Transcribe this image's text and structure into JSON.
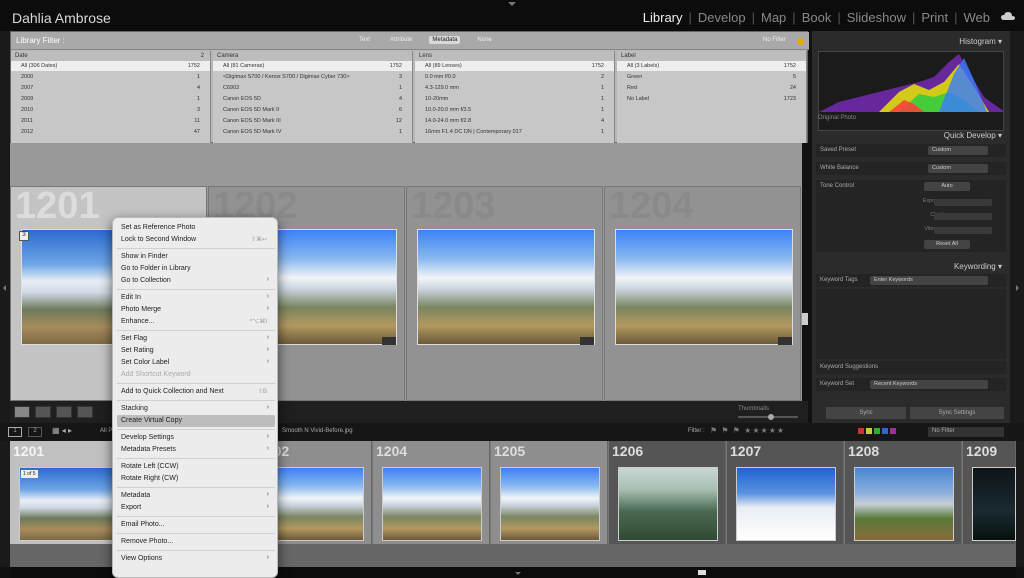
{
  "identity": "Dahlia Ambrose",
  "modules": [
    "Library",
    "Develop",
    "Map",
    "Book",
    "Slideshow",
    "Print",
    "Web"
  ],
  "active_module": "Library",
  "library_filter": {
    "title": "Library Filter :",
    "tabs": [
      "Text",
      "Attribute",
      "Metadata",
      "None"
    ],
    "active_tab": "Metadata",
    "preset": "No Filter",
    "columns": [
      {
        "header": "Date",
        "header_count": "2",
        "rows": [
          {
            "label": "All (306 Dates)",
            "count": "1752"
          },
          {
            "label": "2000",
            "count": "1"
          },
          {
            "label": "2007",
            "count": "4"
          },
          {
            "label": "2009",
            "count": "1"
          },
          {
            "label": "2010",
            "count": "3"
          },
          {
            "label": "2011",
            "count": "11"
          },
          {
            "label": "2012",
            "count": "47"
          }
        ]
      },
      {
        "header": "Camera",
        "header_count": "",
        "rows": [
          {
            "label": "All (81 Cameras)",
            "count": "1752"
          },
          {
            "label": "<Digimax S700 / Kenox S700 / Digimax Cyber 730>",
            "count": "3"
          },
          {
            "label": "C6903",
            "count": "1"
          },
          {
            "label": "Canon EOS 5D",
            "count": "4"
          },
          {
            "label": "Canon EOS 5D Mark II",
            "count": "6"
          },
          {
            "label": "Canon EOS 5D Mark III",
            "count": "12"
          },
          {
            "label": "Canon EOS 5D Mark IV",
            "count": "1"
          }
        ]
      },
      {
        "header": "Lens",
        "header_count": "",
        "rows": [
          {
            "label": "All (89 Lenses)",
            "count": "1752"
          },
          {
            "label": "0.0 mm f/0.0",
            "count": "2"
          },
          {
            "label": "4.3-129.0 mm",
            "count": "1"
          },
          {
            "label": "10-20mm",
            "count": "1"
          },
          {
            "label": "10.0-20.0 mm f/3.5",
            "count": "1"
          },
          {
            "label": "14.0-24.0 mm f/2.8",
            "count": "4"
          },
          {
            "label": "16mm F1.4 DC DN | Contemporary 017",
            "count": "1"
          }
        ]
      },
      {
        "header": "Label",
        "header_count": "",
        "rows": [
          {
            "label": "All (3 Labels)",
            "count": "1752"
          },
          {
            "label": "Green",
            "count": "5"
          },
          {
            "label": "Red",
            "count": "24"
          },
          {
            "label": "No Label",
            "count": "1723"
          }
        ]
      }
    ]
  },
  "grid": {
    "cells": [
      {
        "number": "1201",
        "badge": "3"
      },
      {
        "number": "1202",
        "badge": ""
      },
      {
        "number": "1203",
        "badge": ""
      },
      {
        "number": "1204",
        "badge": ""
      }
    ],
    "thumbnails_label": "Thumbnails"
  },
  "right_panel": {
    "histogram_title": "Histogram",
    "original_photo": "Original Photo",
    "quick_develop_title": "Quick Develop",
    "saved_preset_label": "Saved Preset",
    "saved_preset_value": "Custom",
    "white_balance_label": "White Balance",
    "white_balance_value": "Custom",
    "tone_control_label": "Tone Control",
    "auto_label": "Auto",
    "tone_rows": [
      "Exposure",
      "Clarity",
      "Vibrance"
    ],
    "reset_all": "Reset All",
    "keywording_title": "Keywording",
    "keyword_tags_label": "Keyword Tags",
    "keyword_tags_value": "Enter Keywords",
    "keyword_suggestions": "Keyword Suggestions",
    "keyword_set_label": "Keyword Set",
    "keyword_set_value": "Recent Keywords",
    "sync": "Sync",
    "sync_settings": "Sync Settings"
  },
  "filmstrip_bar": {
    "view_buttons": [
      "1",
      "2"
    ],
    "path_prefix": "All P",
    "path_suffix": "Smooth N Vivid-Before.jpg",
    "filter_label": "Filter :",
    "filter_value": "No Filter"
  },
  "filmstrip": [
    {
      "number": "1201",
      "badge": "1 of 5"
    },
    {
      "number": "1202",
      "badge": ""
    },
    {
      "number": "1204",
      "badge": ""
    },
    {
      "number": "1205",
      "badge": ""
    },
    {
      "number": "1206",
      "badge": ""
    },
    {
      "number": "1207",
      "badge": ""
    },
    {
      "number": "1208",
      "badge": ""
    },
    {
      "number": "1209",
      "badge": ""
    }
  ],
  "context_menu": {
    "items": [
      {
        "label": "Set as Reference Photo",
        "shortcut": "",
        "submenu": false,
        "disabled": false,
        "highlighted": false,
        "sep_after": false
      },
      {
        "label": "Lock to Second Window",
        "shortcut": "⇧⌘↩",
        "submenu": false,
        "disabled": false,
        "highlighted": false,
        "sep_after": true
      },
      {
        "label": "Show in Finder",
        "shortcut": "",
        "submenu": false,
        "disabled": false,
        "highlighted": false,
        "sep_after": false
      },
      {
        "label": "Go to Folder in Library",
        "shortcut": "",
        "submenu": false,
        "disabled": false,
        "highlighted": false,
        "sep_after": false
      },
      {
        "label": "Go to Collection",
        "shortcut": "",
        "submenu": true,
        "disabled": false,
        "highlighted": false,
        "sep_after": true
      },
      {
        "label": "Edit In",
        "shortcut": "",
        "submenu": true,
        "disabled": false,
        "highlighted": false,
        "sep_after": false
      },
      {
        "label": "Photo Merge",
        "shortcut": "",
        "submenu": true,
        "disabled": false,
        "highlighted": false,
        "sep_after": false
      },
      {
        "label": "Enhance...",
        "shortcut": "^⌥⌘I",
        "submenu": false,
        "disabled": false,
        "highlighted": false,
        "sep_after": true
      },
      {
        "label": "Set Flag",
        "shortcut": "",
        "submenu": true,
        "disabled": false,
        "highlighted": false,
        "sep_after": false
      },
      {
        "label": "Set Rating",
        "shortcut": "",
        "submenu": true,
        "disabled": false,
        "highlighted": false,
        "sep_after": false
      },
      {
        "label": "Set Color Label",
        "shortcut": "",
        "submenu": true,
        "disabled": false,
        "highlighted": false,
        "sep_after": false
      },
      {
        "label": "Add Shortcut Keyword",
        "shortcut": "",
        "submenu": false,
        "disabled": true,
        "highlighted": false,
        "sep_after": true
      },
      {
        "label": "Add to Quick Collection and Next",
        "shortcut": "⇧B",
        "submenu": false,
        "disabled": false,
        "highlighted": false,
        "sep_after": true
      },
      {
        "label": "Stacking",
        "shortcut": "",
        "submenu": true,
        "disabled": false,
        "highlighted": false,
        "sep_after": false
      },
      {
        "label": "Create Virtual Copy",
        "shortcut": "",
        "submenu": false,
        "disabled": false,
        "highlighted": true,
        "sep_after": true
      },
      {
        "label": "Develop Settings",
        "shortcut": "",
        "submenu": true,
        "disabled": false,
        "highlighted": false,
        "sep_after": false
      },
      {
        "label": "Metadata Presets",
        "shortcut": "",
        "submenu": true,
        "disabled": false,
        "highlighted": false,
        "sep_after": true
      },
      {
        "label": "Rotate Left (CCW)",
        "shortcut": "",
        "submenu": false,
        "disabled": false,
        "highlighted": false,
        "sep_after": false
      },
      {
        "label": "Rotate Right (CW)",
        "shortcut": "",
        "submenu": false,
        "disabled": false,
        "highlighted": false,
        "sep_after": true
      },
      {
        "label": "Metadata",
        "shortcut": "",
        "submenu": true,
        "disabled": false,
        "highlighted": false,
        "sep_after": false
      },
      {
        "label": "Export",
        "shortcut": "",
        "submenu": true,
        "disabled": false,
        "highlighted": false,
        "sep_after": true
      },
      {
        "label": "Email Photo...",
        "shortcut": "",
        "submenu": false,
        "disabled": false,
        "highlighted": false,
        "sep_after": true
      },
      {
        "label": "Remove Photo...",
        "shortcut": "",
        "submenu": false,
        "disabled": false,
        "highlighted": false,
        "sep_after": true
      },
      {
        "label": "View Options",
        "shortcut": "",
        "submenu": true,
        "disabled": false,
        "highlighted": false,
        "sep_after": false
      }
    ]
  },
  "colors": {
    "accent": "#eeeeee",
    "panel_bg": "#2b2b2b",
    "grid_bg": "#999999",
    "menu_bg": "#ececec"
  },
  "icons": [
    "cloud-icon",
    "grid-view-icon",
    "loupe-view-icon",
    "compare-view-icon",
    "survey-view-icon",
    "chevron-down-icon",
    "submenu-arrow-icon",
    "lock-icon"
  ]
}
